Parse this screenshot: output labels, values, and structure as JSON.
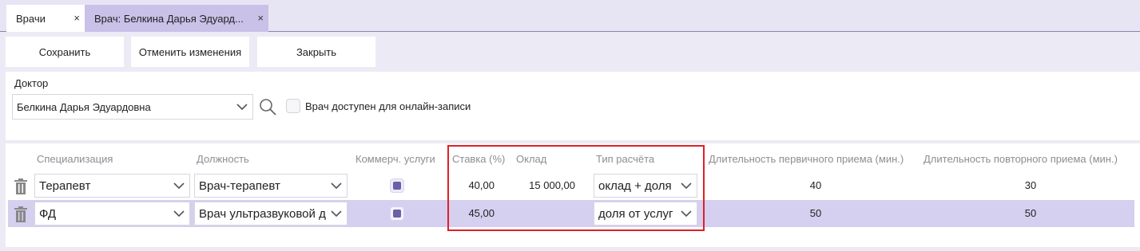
{
  "tabs": [
    {
      "label": "Врачи",
      "close": "×"
    },
    {
      "label": "Врач: Белкина Дарья Эдуард...",
      "close": "×"
    }
  ],
  "toolbar": {
    "save_label": "Сохранить",
    "cancel_label": "Отменить изменения",
    "close_label": "Закрыть"
  },
  "doctor": {
    "label": "Доктор",
    "value": "Белкина Дарья Эдуардовна",
    "online_label": "Врач доступен для онлайн-записи"
  },
  "grid": {
    "headers": {
      "specialization": "Специализация",
      "position": "Должность",
      "commercial": "Коммерч. услуги",
      "rate": "Ставка (%)",
      "salary": "Оклад",
      "calc_type": "Тип расчёта",
      "first_duration": "Длительность первичного приема (мин.)",
      "repeat_duration": "Длительность повторного приема (мин.)"
    },
    "rows": [
      {
        "specialization": "Терапевт",
        "position": "Врач-терапевт",
        "rate": "40,00",
        "salary": "15 000,00",
        "calc_type": "оклад + доля",
        "first_duration": "40",
        "repeat_duration": "30"
      },
      {
        "specialization": "ФД",
        "position": "Врач ультразвуковой д",
        "rate": "45,00",
        "salary": "",
        "calc_type": "доля от услуг",
        "first_duration": "50",
        "repeat_duration": "50"
      }
    ]
  },
  "colors": {
    "accent": "#6b5fa8",
    "selected_row": "#d5cff0",
    "active_tab": "#c9c1e8",
    "highlight": "#e01f26"
  }
}
